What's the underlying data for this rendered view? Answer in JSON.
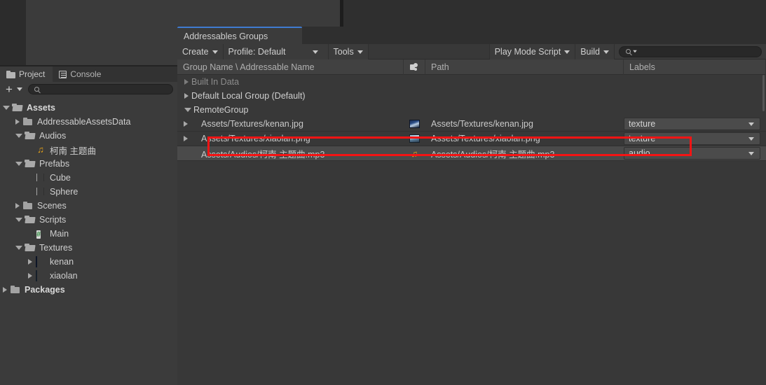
{
  "project_panel": {
    "tabs": [
      {
        "label": "Project",
        "icon": "folder-icon",
        "active": true
      },
      {
        "label": "Console",
        "icon": "console-icon",
        "active": false
      }
    ],
    "toolbar": {
      "add_label": "+",
      "search_placeholder": ""
    },
    "tree": [
      {
        "label": "Assets",
        "depth": 0,
        "arrow": "open",
        "icon": "folder-open",
        "bold": true
      },
      {
        "label": "AddressableAssetsData",
        "depth": 1,
        "arrow": "closed",
        "icon": "folder-closed",
        "bold": false
      },
      {
        "label": "Audios",
        "depth": 1,
        "arrow": "open",
        "icon": "folder-open",
        "bold": false
      },
      {
        "label": "柯南 主题曲",
        "depth": 2,
        "arrow": "none",
        "icon": "music",
        "bold": false
      },
      {
        "label": "Prefabs",
        "depth": 1,
        "arrow": "open",
        "icon": "folder-open",
        "bold": false
      },
      {
        "label": "Cube",
        "depth": 2,
        "arrow": "none",
        "icon": "cube",
        "bold": false
      },
      {
        "label": "Sphere",
        "depth": 2,
        "arrow": "none",
        "icon": "cube",
        "bold": false
      },
      {
        "label": "Scenes",
        "depth": 1,
        "arrow": "closed",
        "icon": "folder-closed",
        "bold": false
      },
      {
        "label": "Scripts",
        "depth": 1,
        "arrow": "open",
        "icon": "folder-open",
        "bold": false
      },
      {
        "label": "Main",
        "depth": 2,
        "arrow": "none",
        "icon": "script",
        "bold": false
      },
      {
        "label": "Textures",
        "depth": 1,
        "arrow": "open",
        "icon": "folder-open",
        "bold": false
      },
      {
        "label": "kenan",
        "depth": 2,
        "arrow": "closed",
        "icon": "thumb-kenan",
        "bold": false
      },
      {
        "label": "xiaolan",
        "depth": 2,
        "arrow": "closed",
        "icon": "thumb-xiaolan",
        "bold": false
      },
      {
        "label": "Packages",
        "depth": 0,
        "arrow": "closed",
        "icon": "folder-closed",
        "bold": true
      }
    ]
  },
  "addressables": {
    "tab_title": "Addressables Groups",
    "toolbar": {
      "create": "Create",
      "profile": "Profile: Default",
      "tools": "Tools",
      "play_mode_script": "Play Mode Script",
      "build": "Build",
      "search_placeholder": ""
    },
    "columns": {
      "group_name": "Group Name \\ Addressable Name",
      "icon_col": "shape-icon",
      "path": "Path",
      "labels": "Labels"
    },
    "groups": [
      {
        "name": "Built In Data",
        "arrow": "closed",
        "dim": true
      },
      {
        "name": "Default Local Group (Default)",
        "arrow": "closed",
        "dim": false
      },
      {
        "name": "RemoteGroup",
        "arrow": "open",
        "dim": false
      }
    ],
    "entries": [
      {
        "name": "Assets/Textures/kenan.jpg",
        "arrow": "closed",
        "icon": "thumb-kenan",
        "path": "Assets/Textures/kenan.jpg",
        "label": "texture",
        "selected": false
      },
      {
        "name": "Assets/Textures/xiaolan.png",
        "arrow": "closed",
        "icon": "thumb-xiaolan",
        "path": "Assets/Textures/xiaolan.png",
        "label": "texture",
        "selected": false
      },
      {
        "name": "Assets/Audios/柯南 主题曲.mp3",
        "arrow": "none",
        "icon": "music-note",
        "path": "Assets/Audios/柯南 主题曲.mp3",
        "label": "audio",
        "selected": true
      }
    ],
    "highlight_color": "#f51414"
  }
}
